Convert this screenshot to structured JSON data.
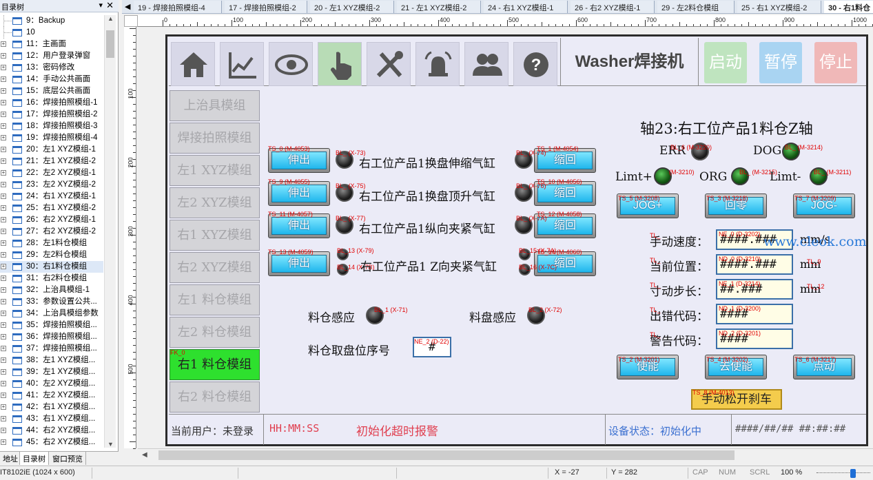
{
  "left_panel": {
    "title": "目录树",
    "close": "✕",
    "items": [
      {
        "label": "9：Backup",
        "exp": false
      },
      {
        "label": "10",
        "exp": false
      },
      {
        "label": "11：主画面",
        "exp": true
      },
      {
        "label": "12：用户登录弹窗",
        "exp": true
      },
      {
        "label": "13：密码修改",
        "exp": true
      },
      {
        "label": "14：手动公共画面",
        "exp": true
      },
      {
        "label": "15：底层公共画面",
        "exp": true
      },
      {
        "label": "16：焊接拍照模组-1",
        "exp": true
      },
      {
        "label": "17：焊接拍照模组-2",
        "exp": true
      },
      {
        "label": "18：焊接拍照模组-3",
        "exp": true
      },
      {
        "label": "19：焊接拍照模组-4",
        "exp": true
      },
      {
        "label": "20：左1 XYZ模组-1",
        "exp": true
      },
      {
        "label": "21：左1 XYZ模组-2",
        "exp": true
      },
      {
        "label": "22：左2 XYZ模组-1",
        "exp": true
      },
      {
        "label": "23：左2 XYZ模组-2",
        "exp": true
      },
      {
        "label": "24：右1 XYZ模组-1",
        "exp": true
      },
      {
        "label": "25：右1 XYZ模组-2",
        "exp": true
      },
      {
        "label": "26：右2 XYZ模组-1",
        "exp": true
      },
      {
        "label": "27：右2 XYZ模组-2",
        "exp": true
      },
      {
        "label": "28：左1料仓模组",
        "exp": true
      },
      {
        "label": "29：左2料仓模组",
        "exp": true
      },
      {
        "label": "30：右1料仓模组",
        "exp": true,
        "sel": true
      },
      {
        "label": "31：右2料仓模组",
        "exp": true
      },
      {
        "label": "32：上治具模组-1",
        "exp": true
      },
      {
        "label": "33：参数设置公共...",
        "exp": true
      },
      {
        "label": "34：上治具模组参数",
        "exp": true
      },
      {
        "label": "35：焊接拍照模组...",
        "exp": true
      },
      {
        "label": "36：焊接拍照模组...",
        "exp": true
      },
      {
        "label": "37：焊接拍照模组...",
        "exp": true
      },
      {
        "label": "38：左1 XYZ模组...",
        "exp": true
      },
      {
        "label": "39：左1 XYZ模组...",
        "exp": true
      },
      {
        "label": "40：左2 XYZ模组...",
        "exp": true
      },
      {
        "label": "41：左2 XYZ模组...",
        "exp": true
      },
      {
        "label": "42：右1 XYZ模组...",
        "exp": true
      },
      {
        "label": "43：右1 XYZ模组...",
        "exp": true
      },
      {
        "label": "44：右2 XYZ模组...",
        "exp": true
      },
      {
        "label": "45：右2 XYZ模组...",
        "exp": true
      }
    ],
    "tabs": [
      "地址",
      "目录树",
      "窗口预览"
    ]
  },
  "tabs": [
    "19 - 焊接拍照模组-4",
    "17 - 焊接拍照模组-2",
    "20 - 左1 XYZ模组-2",
    "21 - 左1 XYZ模组-2",
    "24 - 右1 XYZ模组-1",
    "26 - 右2 XYZ模组-1",
    "29 - 左2料仓模组",
    "25 - 右1 XYZ模组-2",
    "30 - 右1料仓"
  ],
  "ruler": {
    "h": [
      "0",
      "100",
      "200",
      "300",
      "400",
      "500",
      "600",
      "700",
      "800",
      "900",
      "1000"
    ],
    "v": [
      "100",
      "200",
      "300",
      "400",
      "500"
    ]
  },
  "hmi": {
    "title": "Washer焊接机",
    "ctrl": {
      "start": "启动",
      "pause": "暂停",
      "stop": "停止"
    },
    "sidebar": [
      "上治具模组",
      "焊接拍照模组",
      "左1 XYZ模组",
      "左2 XYZ模组",
      "右1 XYZ模组",
      "右2 XYZ模组",
      "左1 料仓模组",
      "左2 料仓模组",
      "右1 料仓模组",
      "右2 料仓模组"
    ],
    "sidebar_tag": "FK_0",
    "cyl": [
      {
        "label": "右工位产品1换盘伸缩气缸",
        "out": "伸出",
        "ret": "缩回",
        "t1": "TS_0 (M-4053)",
        "t2": "TS_1 (M-4054)",
        "l1": "BL_ (X-73)",
        "l2": "BL_ (X-74)"
      },
      {
        "label": "右工位产品1换盘顶升气缸",
        "out": "伸出",
        "ret": "缩回",
        "t1": "TS_9 (M-4055)",
        "t2": "TS_10 (M-4056)",
        "l1": "BL_ (X-75)",
        "l2": "BL_ (X-76)"
      },
      {
        "label": "右工位产品1纵向夹紧气缸",
        "out": "伸出",
        "ret": "缩回",
        "t1": "TS_11 (M-4057)",
        "t2": "TS_12 (M-4058)",
        "l1": "BL_ (X-77)",
        "l2": "BL_ (X-7A)"
      },
      {
        "label": "右工位产品1 Z向夹紧气缸",
        "out": "伸出",
        "ret": "缩回",
        "t1": "TS_13 (M-4059)",
        "t2": "TS_14 (M-4060)",
        "l1": "BL_13 (X-79)",
        "l1b": "BL_14 (X-7B)",
        "l2": "BL_15 (X-7A)",
        "l2b": "BL_16 (X-7C)"
      }
    ],
    "sense": {
      "bin": "料仓感应",
      "bin_tag": "BL_1 (X-71)",
      "tray": "料盘感应",
      "tray_tag": "BL_2 (X-72)",
      "pos": "料仓取盘位序号",
      "pos_tag": "NE_2 (D-22)",
      "pos_val": "#"
    },
    "axis": {
      "title": "轴23:右工位产品1料仓Z轴",
      "err": "ERR",
      "err_tag": "BL_6 (M-3220)",
      "dog": "DOG",
      "dog_tag": "BL_ (M-3214)",
      "lp": "Limt+",
      "lp_tag": "(M-3210)",
      "org": "ORG",
      "org_tag": "BL_ (M-3215)",
      "lm": "Limt-",
      "lm_tag": "BL_ (M-3211)",
      "jogp": "JOG+",
      "jogp_tag": "TS_5 (M-3208)",
      "home": "回零",
      "home_tag": "TS_3 (M-3218)",
      "jogm": "JOG-",
      "jogm_tag": "TS_7 (M-3209)",
      "fields": [
        {
          "label": "手动速度：",
          "val": "####.###",
          "unit": "mm/s",
          "tag": "NE_0 (D-3202)",
          "ltag": "TL_"
        },
        {
          "label": "当前位置：",
          "val": "####.###",
          "unit": "mm",
          "tag": "ND_0 (D-3210)",
          "ltag": "TL_",
          "utag": "TL_9"
        },
        {
          "label": "寸动步长：",
          "val": "##.###",
          "unit": "mm",
          "tag": "NE_1 (D-3214)",
          "ltag": "TL_",
          "utag": "TL_12"
        },
        {
          "label": "出错代码：",
          "val": "####",
          "unit": "",
          "tag": "ND_1 (D-3200)",
          "ltag": "TL_"
        },
        {
          "label": "警告代码：",
          "val": "####",
          "unit": "",
          "tag": "ND_2 (D-3201)",
          "ltag": "TL_"
        }
      ],
      "en": "使能",
      "en_tag": "TS_2 (M-3201)",
      "dis": "去使能",
      "dis_tag": "TS_4 (M-3202)",
      "inch": "点动",
      "inch_tag": "TS_6 (M-3217)",
      "brake": "手动松开刹车",
      "brake_tag": "TS_8 (M-4013)"
    },
    "status": {
      "user": "当前用户：未登录",
      "time": "HH:MM:SS",
      "alarm": "初始化超时报警",
      "dev": "设备状态：初始化中",
      "date": "####/##/## ##:##:##"
    },
    "watermark": "www.cleok.com"
  },
  "bottom": {
    "model": "IT8102iE (1024 x 600)",
    "x": "X = -27",
    "y": "Y = 282",
    "caps": "CAP",
    "num": "NUM",
    "scrl": "SCRL",
    "zoom": "100 %"
  }
}
